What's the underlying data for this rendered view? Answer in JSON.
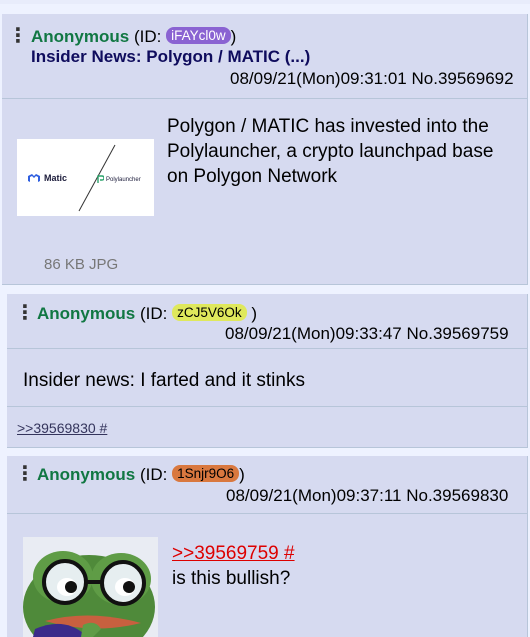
{
  "posts": [
    {
      "name": "Anonymous",
      "id_prefix": "(ID:",
      "id": "iFAYcl0w",
      "id_suffix": ")",
      "id_color": "#8a63d2",
      "id_text_color": "#ffffff",
      "subject": "Insider News: Polygon / MATIC (...)",
      "datetime": "08/09/21(Mon)09:31:01",
      "number": "No.39569692",
      "text": "Polygon / MATIC has invested into the Polylauncher, a crypto launchpad base on Polygon Network",
      "file": {
        "size": "86 KB JPG",
        "logo_left": "Matic",
        "logo_right": "Polylauncher"
      }
    },
    {
      "name": "Anonymous",
      "id_prefix": "(ID:",
      "id": "zCJ5V6Ok",
      "id_suffix": ")",
      "id_color": "#dfe85c",
      "id_text_color": "#000000",
      "datetime": "08/09/21(Mon)09:33:47",
      "number": "No.39569759",
      "text": "Insider news: I farted and it stinks",
      "backlink": ">>39569830 #"
    },
    {
      "name": "Anonymous",
      "id_prefix": "(ID:",
      "id": "1Snjr9O6",
      "id_suffix": ")",
      "id_color": "#d9783f",
      "id_text_color": "#000000",
      "datetime": "08/09/21(Mon)09:37:11",
      "number": "No.39569830",
      "quote": ">>39569759 #",
      "text": "is this bullish?"
    }
  ],
  "menu_glyph": "⋮",
  "icons": {
    "menu": "vertical-dots-icon"
  }
}
